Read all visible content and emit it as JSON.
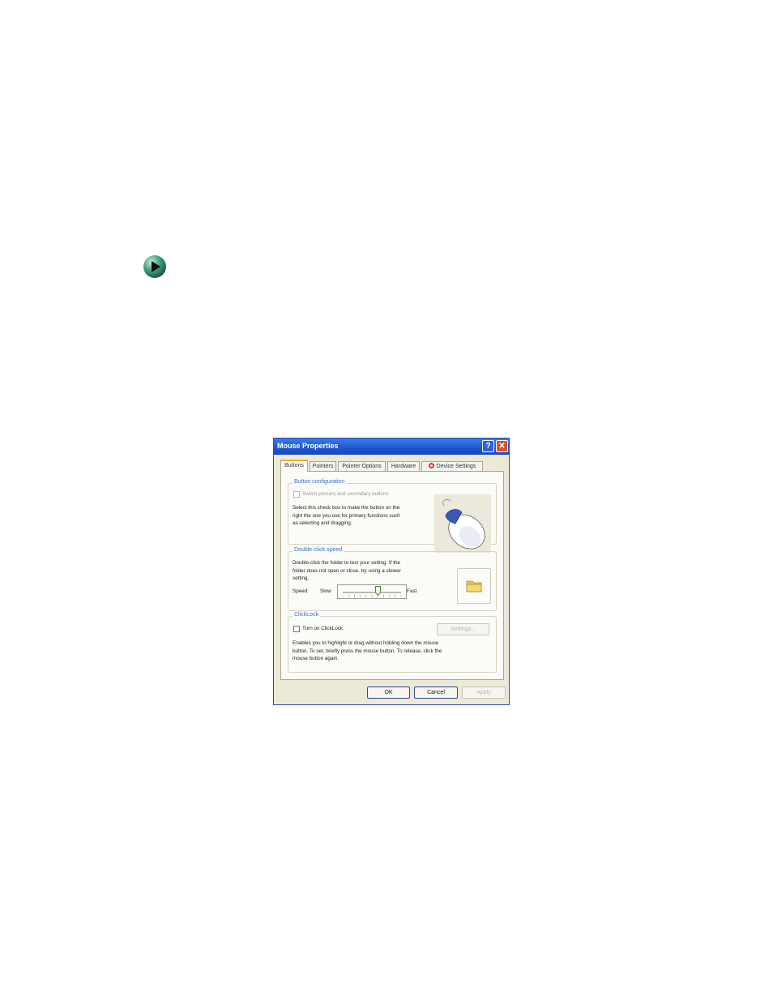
{
  "window": {
    "title": "Mouse Properties"
  },
  "tabs": [
    {
      "label": "Buttons",
      "active": true
    },
    {
      "label": "Pointers"
    },
    {
      "label": "Pointer Options"
    },
    {
      "label": "Hardware"
    },
    {
      "label": "Device Settings",
      "icon": "device-settings-icon"
    }
  ],
  "button_configuration": {
    "heading": "Button configuration",
    "checkbox_label": "Switch primary and secondary buttons",
    "description_lines": [
      "Select this check box to make the button on the",
      "right the one you use for primary functions such",
      "as selecting and dragging."
    ]
  },
  "double_click": {
    "heading": "Double-click speed",
    "description_lines": [
      "Double-click the folder to test your setting. If the",
      "folder does not open or close, try using a slower",
      "setting."
    ],
    "speed_label": "Speed:",
    "slow_label": "Slow",
    "fast_label": "Fast",
    "speed_value": 0.6
  },
  "clicklock": {
    "heading": "ClickLock",
    "checkbox_label": "Turn on ClickLock",
    "settings_button": "Settings...",
    "description_lines": [
      "Enables you to highlight or drag without holding down the mouse",
      "button. To set, briefly press the mouse button. To release, click the",
      "mouse button again."
    ]
  },
  "footer": {
    "ok": "OK",
    "cancel": "Cancel",
    "apply": "Apply"
  },
  "colors": {
    "title_bar": "#1f55d1",
    "close_button": "#d9532c",
    "accent": "#3d6bd1",
    "active_tab_highlight": "#f0b030"
  }
}
